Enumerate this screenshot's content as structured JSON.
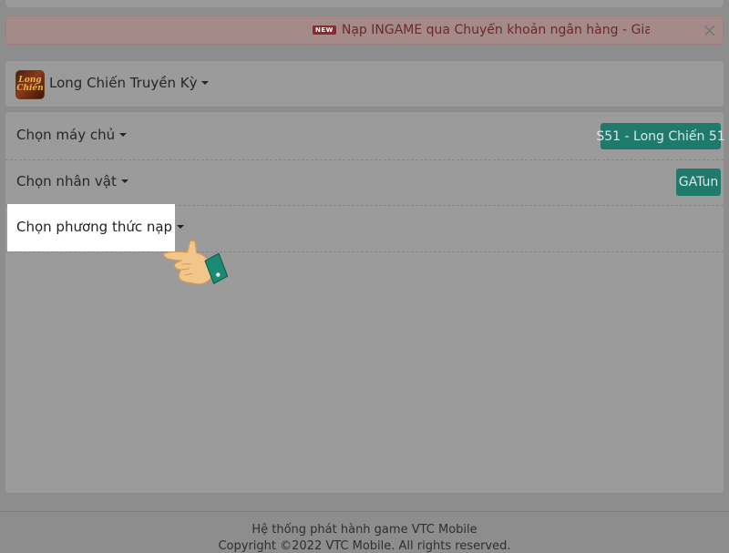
{
  "notice": {
    "badge": "NEW",
    "text": "Nạp INGAME qua Chuyển khoản ngân hàng - Giao dịch nhanh",
    "close_label": "×"
  },
  "game": {
    "logo_text": "Long Chiến",
    "name": "Long Chiến Truyền Kỳ"
  },
  "server": {
    "label": "Chọn máy chủ",
    "value": "S51 - Long Chiến 51"
  },
  "character": {
    "label": "Chọn nhân vật",
    "value": "GATun"
  },
  "payment": {
    "label": "Chọn phương thức nạp"
  },
  "footer": {
    "publisher": "Hệ thống phát hành game VTC Mobile",
    "copyright": "Copyright ©2022 VTC Mobile. All rights reserved."
  },
  "colors": {
    "overlay": "#8d8d8d",
    "accent": "#1f7a6c",
    "highlight": "#ffffff",
    "notice_text": "#6a2a2a"
  },
  "icons": {
    "caret": "caret-down-icon",
    "hand": "pointing-hand-icon",
    "close": "close-icon"
  }
}
